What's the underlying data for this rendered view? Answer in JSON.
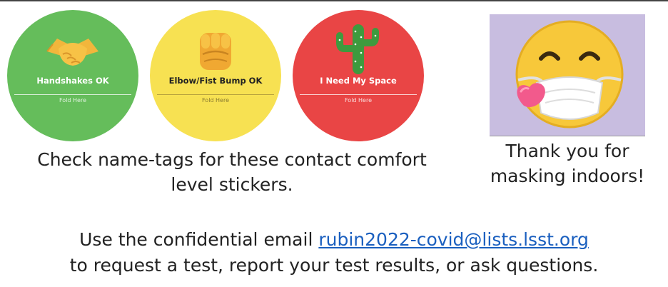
{
  "stickers": [
    {
      "label": "Handshakes OK",
      "fold": "Fold Here",
      "color": "#65bd5b",
      "icon": "handshake-icon"
    },
    {
      "label": "Elbow/Fist Bump OK",
      "fold": "Fold Here",
      "color": "#f7e152",
      "icon": "fist-bump-icon"
    },
    {
      "label": "I Need My Space",
      "fold": "Fold Here",
      "color": "#e94545",
      "icon": "cactus-icon"
    }
  ],
  "mask_panel": {
    "icon": "face-with-mask-heart-icon",
    "background": "#c8bde0"
  },
  "captions": {
    "stickers": "Check name-tags for these contact comfort level stickers.",
    "masking": "Thank you for masking indoors!"
  },
  "footer": {
    "prefix": "Use the confidential email ",
    "email": "rubin2022-covid@lists.lsst.org",
    "line2": "to request a test, report your test results, or ask questions.",
    "link_color": "#1a5fbf"
  }
}
